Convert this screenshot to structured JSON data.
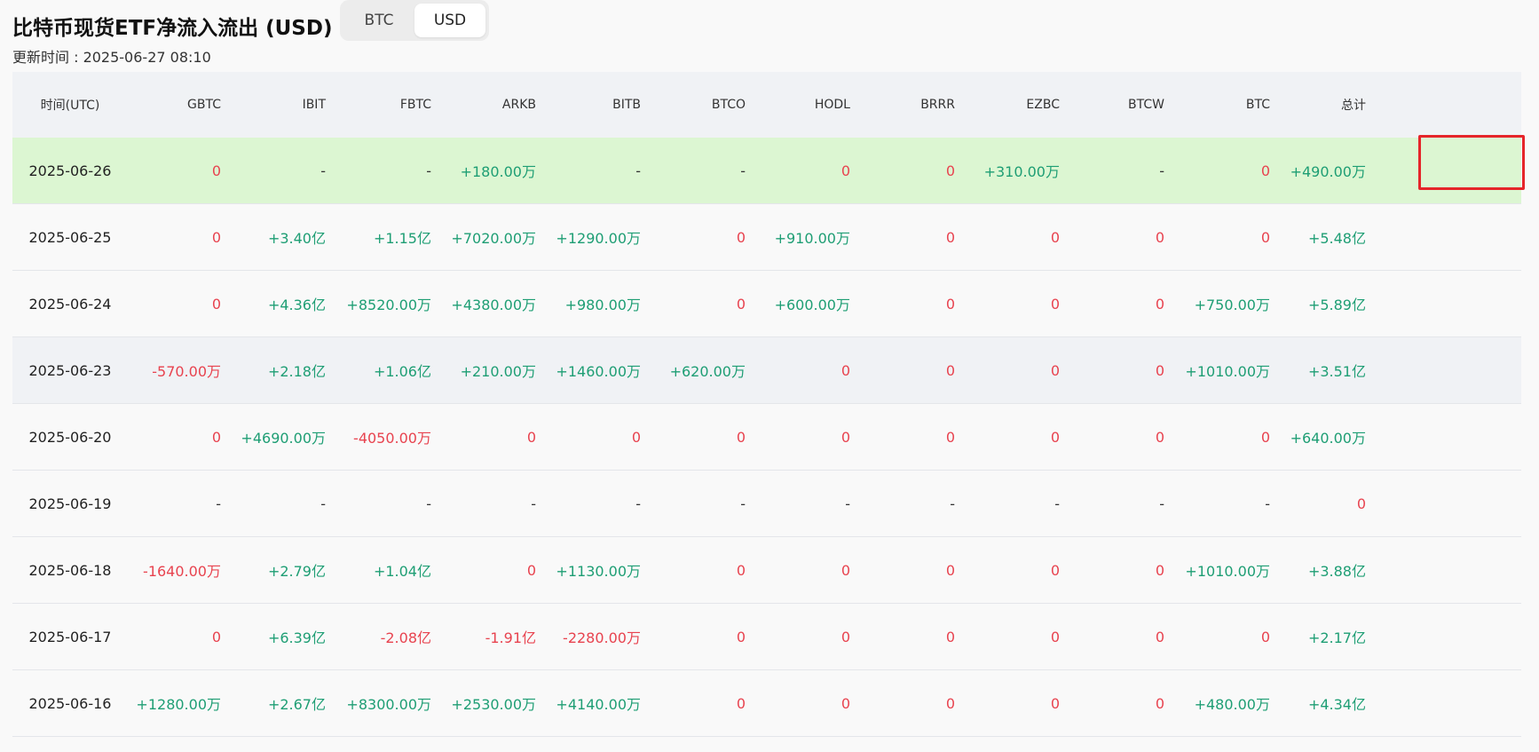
{
  "header": {
    "title": "比特币现货ETF净流入流出 (USD)",
    "update_time": "更新时间 : 2025-06-27 08:10"
  },
  "toggle": {
    "options": [
      "BTC",
      "USD"
    ],
    "selected": "USD"
  },
  "table": {
    "columns": [
      "时间(UTC)",
      "GBTC",
      "IBIT",
      "FBTC",
      "ARKB",
      "BITB",
      "BTCO",
      "HODL",
      "BRRR",
      "EZBC",
      "BTCW",
      "BTC",
      "总计"
    ],
    "rows": [
      {
        "date": "2025-06-26",
        "values": [
          "0",
          "-",
          "-",
          "+180.00万",
          "-",
          "-",
          "0",
          "0",
          "+310.00万",
          "-",
          "0",
          "+490.00万"
        ]
      },
      {
        "date": "2025-06-25",
        "values": [
          "0",
          "+3.40亿",
          "+1.15亿",
          "+7020.00万",
          "+1290.00万",
          "0",
          "+910.00万",
          "0",
          "0",
          "0",
          "0",
          "+5.48亿"
        ]
      },
      {
        "date": "2025-06-24",
        "values": [
          "0",
          "+4.36亿",
          "+8520.00万",
          "+4380.00万",
          "+980.00万",
          "0",
          "+600.00万",
          "0",
          "0",
          "0",
          "+750.00万",
          "+5.89亿"
        ]
      },
      {
        "date": "2025-06-23",
        "values": [
          "-570.00万",
          "+2.18亿",
          "+1.06亿",
          "+210.00万",
          "+1460.00万",
          "+620.00万",
          "0",
          "0",
          "0",
          "0",
          "+1010.00万",
          "+3.51亿"
        ]
      },
      {
        "date": "2025-06-20",
        "values": [
          "0",
          "+4690.00万",
          "-4050.00万",
          "0",
          "0",
          "0",
          "0",
          "0",
          "0",
          "0",
          "0",
          "+640.00万"
        ]
      },
      {
        "date": "2025-06-19",
        "values": [
          "-",
          "-",
          "-",
          "-",
          "-",
          "-",
          "-",
          "-",
          "-",
          "-",
          "-",
          "0"
        ]
      },
      {
        "date": "2025-06-18",
        "values": [
          "-1640.00万",
          "+2.79亿",
          "+1.04亿",
          "0",
          "+1130.00万",
          "0",
          "0",
          "0",
          "0",
          "0",
          "+1010.00万",
          "+3.88亿"
        ]
      },
      {
        "date": "2025-06-17",
        "values": [
          "0",
          "+6.39亿",
          "-2.08亿",
          "-1.91亿",
          "-2280.00万",
          "0",
          "0",
          "0",
          "0",
          "0",
          "0",
          "+2.17亿"
        ]
      },
      {
        "date": "2025-06-16",
        "values": [
          "+1280.00万",
          "+2.67亿",
          "+8300.00万",
          "+2530.00万",
          "+4140.00万",
          "0",
          "0",
          "0",
          "0",
          "0",
          "+480.00万",
          "+4.34亿"
        ]
      }
    ]
  },
  "colors": {
    "positive": "#1e9e74",
    "negative": "#e8434f",
    "highlight_row": "#dcf6d2",
    "highlight_box": "#e5252a"
  }
}
